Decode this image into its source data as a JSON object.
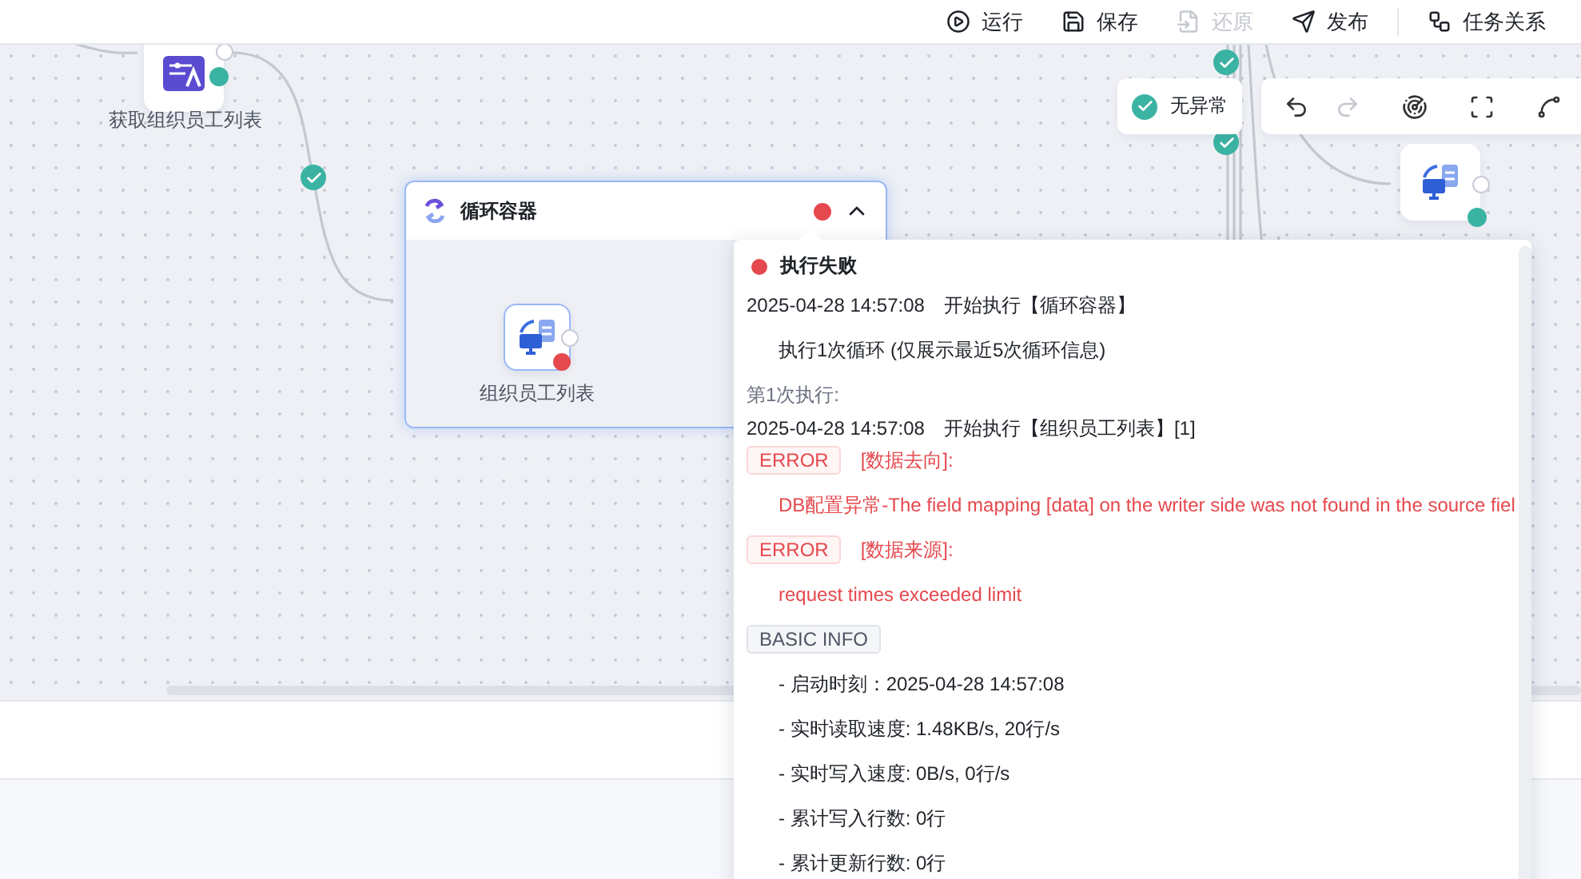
{
  "toolbar": [
    {
      "kind": "run",
      "label": "运行",
      "disabled": false
    },
    {
      "kind": "save",
      "label": "保存",
      "disabled": false
    },
    {
      "kind": "restore",
      "label": "还原",
      "disabled": true
    },
    {
      "kind": "publish",
      "label": "发布",
      "disabled": false
    },
    {
      "kind": "relation",
      "label": "任务关系",
      "disabled": false
    }
  ],
  "canvas": {
    "nodes": [
      {
        "kind": "params",
        "label": "获取组织员工列表",
        "color": "#3bb3a3"
      },
      {
        "kind": "data",
        "color": "#3bb3a3"
      }
    ],
    "container": {
      "title": "循环容器",
      "color": "#e5484d",
      "expanded": true,
      "children": [
        {
          "kind": "data",
          "label": "组织员工列表",
          "color": "#e5484d"
        }
      ]
    },
    "health": {
      "label": "无异常",
      "color": "#3bb3a3"
    },
    "view_tools": [
      {
        "kind": "undo",
        "disabled": false
      },
      {
        "kind": "redo",
        "disabled": true
      },
      {
        "kind": "preview",
        "disabled": false
      },
      {
        "kind": "fit",
        "disabled": false
      },
      {
        "kind": "layout",
        "disabled": false
      }
    ]
  },
  "log_popover": {
    "title": "执行失败",
    "color": "#e5484d",
    "lines": [
      {
        "kind": "log",
        "time": "2025-04-28 14:57:08",
        "text": "开始执行【循环容器】"
      },
      {
        "kind": "note",
        "text": "执行1次循环 (仅展示最近5次循环信息)"
      },
      {
        "kind": "section",
        "text": "第1次执行:"
      },
      {
        "kind": "log",
        "time": "2025-04-28 14:57:08",
        "text": "开始执行【组织员工列表】[1]"
      },
      {
        "kind": "tag",
        "error": true,
        "tag": "ERROR",
        "text": "[数据去向]:"
      },
      {
        "kind": "error",
        "text": "DB配置异常-The field mapping [data] on the writer side was not found in the source fiel"
      },
      {
        "kind": "tag",
        "error": true,
        "tag": "ERROR",
        "text": "[数据来源]:"
      },
      {
        "kind": "error",
        "text": "request times exceeded limit"
      },
      {
        "kind": "tag",
        "error": false,
        "tag": "BASIC INFO"
      },
      {
        "kind": "note",
        "text": "- 启动时刻：2025-04-28 14:57:08"
      },
      {
        "kind": "note",
        "text": "- 实时读取速度: 1.48KB/s, 20行/s"
      },
      {
        "kind": "note",
        "text": "- 实时写入速度: 0B/s, 0行/s"
      },
      {
        "kind": "note",
        "text": "- 累计写入行数: 0行"
      },
      {
        "kind": "note",
        "text": "- 累计更新行数: 0行"
      }
    ]
  }
}
